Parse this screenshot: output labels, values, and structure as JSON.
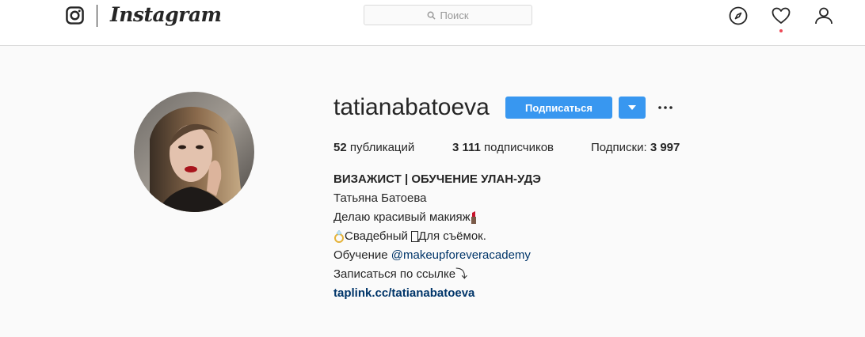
{
  "header": {
    "brand": "Instagram",
    "search_placeholder": "Поиск"
  },
  "profile": {
    "username": "tatianabatoeva",
    "follow_label": "Подписаться",
    "stats": {
      "posts_count": "52",
      "posts_label": " публикаций",
      "followers_count": "3 111",
      "followers_label": " подписчиков",
      "following_label": "Подписки: ",
      "following_count": "3 997"
    },
    "bio": {
      "title": "ВИЗАЖИСТ | ОБУЧЕНИЕ УЛАН-УДЭ",
      "full_name": "Татьяна Батоева",
      "line1": "Делаю красивый макияж",
      "line2": "Свадебный ",
      "line2b": "Для съёмок.",
      "line3_prefix": "Обучение ",
      "line3_mention": "@makeupforeveracademy",
      "line4": "Записаться по ссылке⤵",
      "website": "taplink.cc/tatianabatoeva"
    }
  },
  "colors": {
    "accent": "#3897f0",
    "link": "#003569",
    "notification": "#ed4956"
  }
}
